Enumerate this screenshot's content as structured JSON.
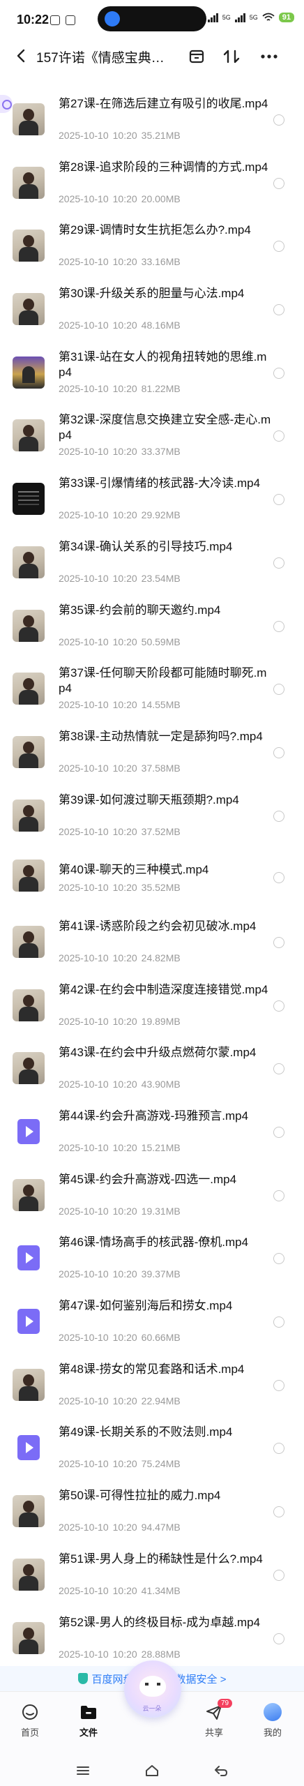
{
  "status_bar": {
    "time": "10:22",
    "network_left": "5G",
    "network_right": "5G",
    "battery": "91"
  },
  "header": {
    "title": "157许诺《情感宝典…",
    "icons": [
      "back-icon",
      "multi-select-icon",
      "sort-icon",
      "more-icon"
    ]
  },
  "files": [
    {
      "name": "第27课-在筛选后建立有吸引的收尾.mp4",
      "date": "2025-10-10",
      "time": "10:20",
      "size": "35.21MB",
      "thumb": "video"
    },
    {
      "name": "第28课-追求阶段的三种调情的方式.mp4",
      "date": "2025-10-10",
      "time": "10:20",
      "size": "20.00MB",
      "thumb": "video"
    },
    {
      "name": "第29课-调情时女生抗拒怎么办?.mp4",
      "date": "2025-10-10",
      "time": "10:20",
      "size": "33.16MB",
      "thumb": "video"
    },
    {
      "name": "第30课-升级关系的胆量与心法.mp4",
      "date": "2025-10-10",
      "time": "10:20",
      "size": "48.16MB",
      "thumb": "video"
    },
    {
      "name": "第31课-站在女人的视角扭转她的思维.mp4",
      "date": "2025-10-10",
      "time": "10:20",
      "size": "81.22MB",
      "thumb": "purple"
    },
    {
      "name": "第32课-深度信息交换建立安全感-走心.mp4",
      "date": "2025-10-10",
      "time": "10:20",
      "size": "33.37MB",
      "thumb": "video"
    },
    {
      "name": "第33课-引爆情绪的核武器-大冷读.mp4",
      "date": "2025-10-10",
      "time": "10:20",
      "size": "29.92MB",
      "thumb": "dark"
    },
    {
      "name": "第34课-确认关系的引导技巧.mp4",
      "date": "2025-10-10",
      "time": "10:20",
      "size": "23.54MB",
      "thumb": "video"
    },
    {
      "name": "第35课-约会前的聊天邀约.mp4",
      "date": "2025-10-10",
      "time": "10:20",
      "size": "50.59MB",
      "thumb": "video"
    },
    {
      "name": "第37课-任何聊天阶段都可能随时聊死.mp4",
      "date": "2025-10-10",
      "time": "10:20",
      "size": "14.55MB",
      "thumb": "video"
    },
    {
      "name": "第38课-主动热情就一定是舔狗吗?.mp4",
      "date": "2025-10-10",
      "time": "10:20",
      "size": "37.58MB",
      "thumb": "video"
    },
    {
      "name": "第39课-如何渡过聊天瓶颈期?.mp4",
      "date": "2025-10-10",
      "time": "10:20",
      "size": "37.52MB",
      "thumb": "video"
    },
    {
      "name": "第40课-聊天的三种模式.mp4",
      "date": "2025-10-10",
      "time": "10:20",
      "size": "35.52MB",
      "thumb": "video"
    },
    {
      "name": "第41课-诱惑阶段之约会初见破冰.mp4",
      "date": "2025-10-10",
      "time": "10:20",
      "size": "24.82MB",
      "thumb": "video"
    },
    {
      "name": "第42课-在约会中制造深度连接错觉.mp4",
      "date": "2025-10-10",
      "time": "10:20",
      "size": "19.89MB",
      "thumb": "video"
    },
    {
      "name": "第43课-在约会中升级点燃荷尔蒙.mp4",
      "date": "2025-10-10",
      "time": "10:20",
      "size": "43.90MB",
      "thumb": "video"
    },
    {
      "name": "第44课-约会升高游戏-玛雅预言.mp4",
      "date": "2025-10-10",
      "time": "10:20",
      "size": "15.21MB",
      "thumb": "icon"
    },
    {
      "name": "第45课-约会升高游戏-四选一.mp4",
      "date": "2025-10-10",
      "time": "10:20",
      "size": "19.31MB",
      "thumb": "video"
    },
    {
      "name": "第46课-情场高手的核武器-僚机.mp4",
      "date": "2025-10-10",
      "time": "10:20",
      "size": "39.37MB",
      "thumb": "icon"
    },
    {
      "name": "第47课-如何鉴别海后和捞女.mp4",
      "date": "2025-10-10",
      "time": "10:20",
      "size": "60.66MB",
      "thumb": "icon"
    },
    {
      "name": "第48课-捞女的常见套路和话术.mp4",
      "date": "2025-10-10",
      "time": "10:20",
      "size": "22.94MB",
      "thumb": "video"
    },
    {
      "name": "第49课-长期关系的不败法则.mp4",
      "date": "2025-10-10",
      "time": "10:20",
      "size": "75.24MB",
      "thumb": "icon"
    },
    {
      "name": "第50课-可得性拉扯的威力.mp4",
      "date": "2025-10-10",
      "time": "10:20",
      "size": "94.47MB",
      "thumb": "video"
    },
    {
      "name": "第51课-男人身上的稀缺性是什么?.mp4",
      "date": "2025-10-10",
      "time": "10:20",
      "size": "41.34MB",
      "thumb": "video"
    },
    {
      "name": "第52课-男人的终极目标-成为卓越.mp4",
      "date": "2025-10-10",
      "time": "10:20",
      "size": "28.88MB",
      "thumb": "video"
    }
  ],
  "safety_banner": {
    "text": "百度网盘保障你的数据安全 >"
  },
  "tabbar": {
    "tabs": [
      {
        "label": "首页",
        "icon": "home-icon"
      },
      {
        "label": "文件",
        "icon": "folder-icon",
        "active": true
      },
      {
        "label": "共享",
        "icon": "share-icon",
        "badge": "79"
      },
      {
        "label": "我的",
        "icon": "avatar-icon"
      }
    ],
    "mascot_label": "云一朵"
  },
  "colors": {
    "accent": "#2c7cf6",
    "play_icon": "#7b6cf6",
    "meta_text": "#9a9a9a",
    "badge": "#f43f5e",
    "battery": "#7cc84b"
  }
}
